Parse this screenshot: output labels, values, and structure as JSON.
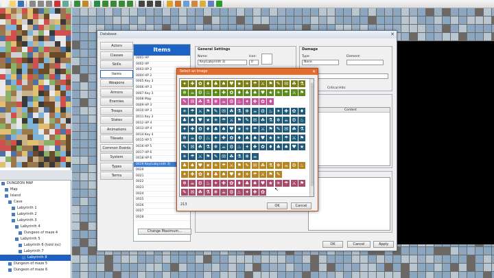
{
  "toolbar": {
    "buttons": [
      "new-icon",
      "open-icon",
      "save-icon",
      "cut-icon",
      "copy-icon",
      "paste-icon",
      "delete-icon",
      "undo-icon",
      "map-mode-icon",
      "event-mode-icon",
      "pencil-icon",
      "rectangle-icon",
      "ellipse-icon",
      "fill-icon",
      "shadow-pen-icon",
      "zoom-in-icon",
      "zoom-out-icon",
      "zoom-reset-icon",
      "database-icon",
      "plugin-icon",
      "sound-icon",
      "character-generator-icon",
      "resource-manager-icon",
      "search-icon",
      "playtest-icon"
    ]
  },
  "tileset_tabs": [
    "A",
    "B",
    "C",
    "D",
    "R"
  ],
  "map_tree": [
    {
      "label": "DUNGEON MAP",
      "indent": 0
    },
    {
      "label": "Map",
      "indent": 1
    },
    {
      "label": "Island",
      "indent": 1
    },
    {
      "label": "Cave",
      "indent": 2
    },
    {
      "label": "Labyrinth 1",
      "indent": 3
    },
    {
      "label": "Labyrinth 2",
      "indent": 3
    },
    {
      "label": "Labyrinth 3",
      "indent": 3
    },
    {
      "label": "Labyrinth 4",
      "indent": 4
    },
    {
      "label": "Dungeon of maze 4",
      "indent": 5
    },
    {
      "label": "Labyrinth 5",
      "indent": 4
    },
    {
      "label": "Labyrinth 6 (hold inc)",
      "indent": 5
    },
    {
      "label": "Labyrinth 7",
      "indent": 5
    },
    {
      "label": "Labyrinth 8",
      "indent": 6,
      "selected": true
    },
    {
      "label": "Dungeon of maze 5",
      "indent": 2
    },
    {
      "label": "Dungeon of maze 6",
      "indent": 2
    }
  ],
  "database": {
    "title": "Database",
    "categories": [
      "Actors",
      "Classes",
      "Skills",
      "Items",
      "Weapons",
      "Armors",
      "Enemies",
      "Troops",
      "States",
      "Animations",
      "Tilesets",
      "Common Events",
      "System",
      "Types",
      "Terms"
    ],
    "selected_category": "Items",
    "list_header": "Items",
    "items": [
      "0001 HP",
      "0002 HP",
      "0003 HP 2",
      "0004 HP 2",
      "0005 Key 3",
      "0006 HP 3",
      "0007 Key 3",
      "0008 Map",
      "0009 HP 3",
      "0010 HP 3",
      "0011 Key 3",
      "0012 HP 4",
      "0013 HP 4",
      "0014 Key 4",
      "0015 HP 5",
      "0016 HP 5",
      "0017 HP 6",
      "0018 HP 6",
      "0019 Key(Labyrinth 3)",
      "0020",
      "0021",
      "0022",
      "0023",
      "0024",
      "0025",
      "0026",
      "0027",
      "0028"
    ],
    "selected_item": "0019 Key(Labyrinth 3)",
    "change_max_label": "Change Maximum...",
    "general_settings_title": "General Settings",
    "name_label": "Name:",
    "name_value": "Key(Labyrinth 3)",
    "icon_label": "Icon:",
    "icon_index": "0",
    "damage_title": "Damage",
    "type_label": "Type:",
    "type_value": "None",
    "element_label": "Element:",
    "critical_label": "Critical Hits:",
    "content_header": "Content",
    "ok_label": "OK",
    "cancel_label": "Cancel",
    "apply_label": "Apply"
  },
  "select_image": {
    "title": "Select an Image",
    "count": "213",
    "ok_label": "OK",
    "cancel_label": "Cancel",
    "row_colors": [
      "#7a7d12",
      "#5a8a1a",
      "#c8559a",
      "#1f5a7a",
      "#1f5a7a",
      "#1f5a7a",
      "#1f5a7a",
      "#1f5a7a",
      "#1f5a7a",
      "#b5831f",
      "#b5831f",
      "#a84a6a",
      "#a84a6a"
    ]
  },
  "colors": {
    "accent": "#1d63c5",
    "dialog_title": "#e36b2d",
    "map_black": "#000000"
  }
}
